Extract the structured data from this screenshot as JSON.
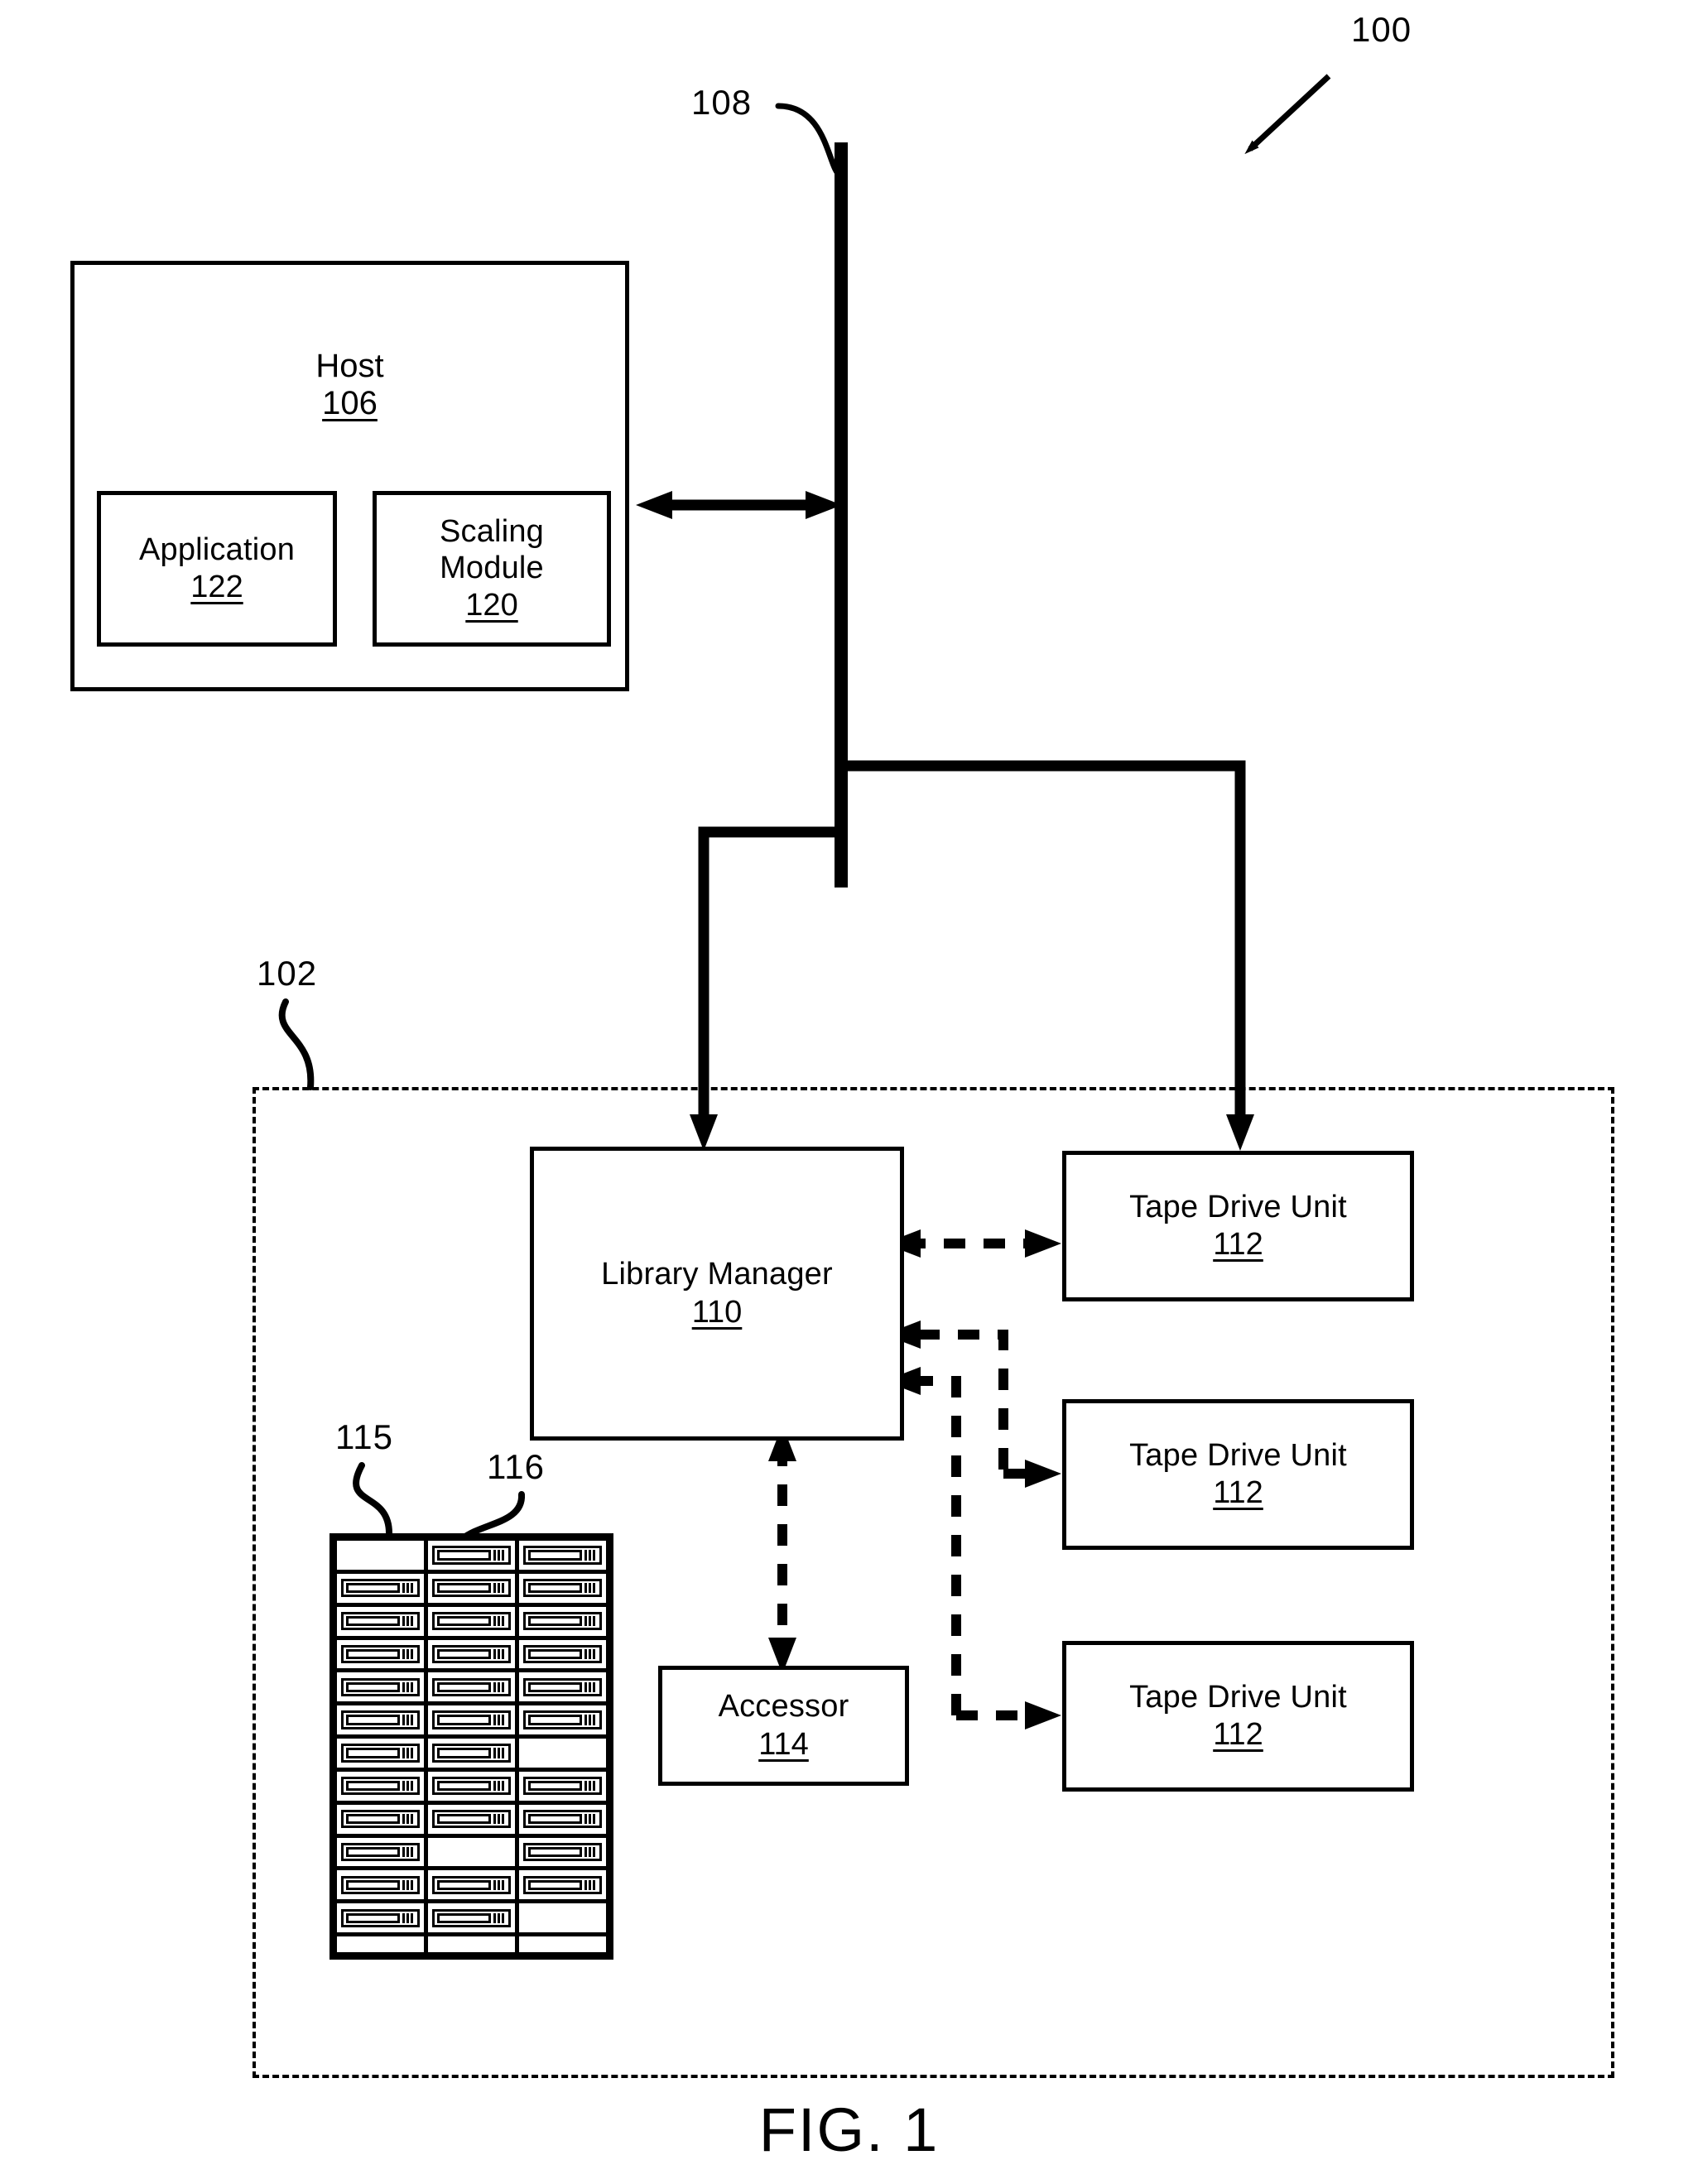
{
  "figure": {
    "caption": "FIG. 1",
    "system_ref": "100",
    "library_ref": "102",
    "bus_ref": "108",
    "magazine_ref": "115",
    "cartridge_ref": "116"
  },
  "host": {
    "title": "Host",
    "ref": "106",
    "modules": [
      {
        "label": "Application",
        "ref": "122"
      },
      {
        "label": "Scaling\nModule",
        "ref": "120"
      }
    ]
  },
  "library": {
    "manager": {
      "label": "Library Manager",
      "ref": "110"
    },
    "accessor": {
      "label": "Accessor",
      "ref": "114"
    },
    "tape_drives": [
      {
        "label": "Tape Drive Unit",
        "ref": "112"
      },
      {
        "label": "Tape Drive Unit",
        "ref": "112"
      },
      {
        "label": "Tape Drive Unit",
        "ref": "112"
      }
    ]
  },
  "magazine": {
    "rows": 13,
    "columns": 3,
    "slots": [
      [
        0,
        1,
        1
      ],
      [
        1,
        1,
        1
      ],
      [
        1,
        1,
        1
      ],
      [
        1,
        1,
        1
      ],
      [
        1,
        1,
        1
      ],
      [
        1,
        1,
        1
      ],
      [
        1,
        1,
        0
      ],
      [
        1,
        1,
        1
      ],
      [
        1,
        1,
        1
      ],
      [
        1,
        0,
        1
      ],
      [
        1,
        1,
        1
      ],
      [
        1,
        1,
        0
      ],
      [
        0,
        0,
        0
      ]
    ]
  },
  "colors": {
    "ink": "#000000",
    "paper": "#ffffff"
  }
}
